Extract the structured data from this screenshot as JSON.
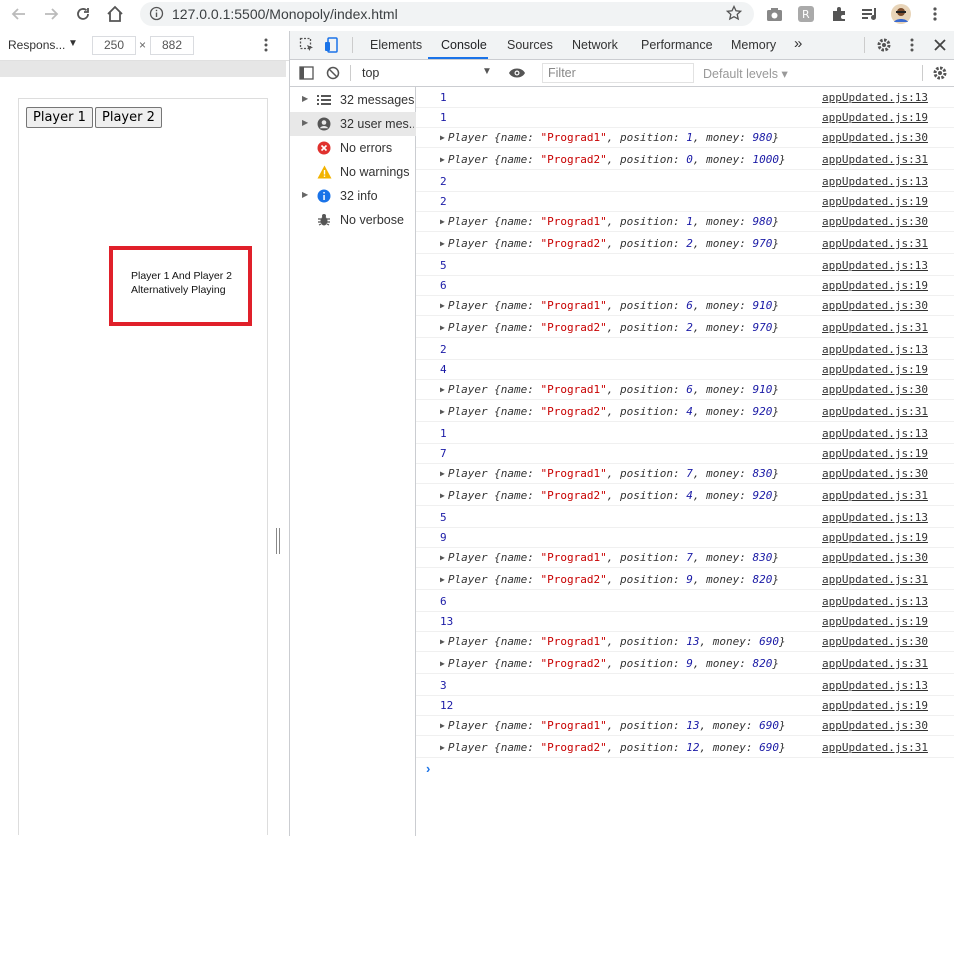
{
  "browser": {
    "url": "127.0.0.1:5500/Monopoly/index.html"
  },
  "device_toolbar": {
    "preset": "Respons...",
    "width": "250",
    "height": "882",
    "times": "×"
  },
  "page": {
    "buttons": [
      "Player 1",
      "Player 2"
    ],
    "message_line1": "Player 1 And Player 2",
    "message_line2": "Alternatively Playing"
  },
  "devtools": {
    "tabs": [
      "Elements",
      "Console",
      "Sources",
      "Network",
      "Performance",
      "Memory"
    ],
    "more_tabs": "»",
    "active_tab": "Console",
    "context": "top",
    "filter_placeholder": "Filter",
    "levels": "Default levels ▾",
    "sidebar": [
      {
        "label": "32 messages",
        "icon": "list-icon",
        "expandable": true
      },
      {
        "label": "32 user mes...",
        "icon": "user-icon",
        "expandable": true
      },
      {
        "label": "No errors",
        "icon": "error-icon",
        "expandable": false
      },
      {
        "label": "No warnings",
        "icon": "warning-icon",
        "expandable": false
      },
      {
        "label": "32 info",
        "icon": "info-icon",
        "expandable": true
      },
      {
        "label": "No verbose",
        "icon": "bug-icon",
        "expandable": false
      }
    ],
    "log": [
      {
        "type": "num",
        "value": "1",
        "src": "appUpdated.js:13"
      },
      {
        "type": "num",
        "value": "1",
        "src": "appUpdated.js:19"
      },
      {
        "type": "obj",
        "name": "Prograd1",
        "position": "1",
        "money": "980",
        "src": "appUpdated.js:30"
      },
      {
        "type": "obj",
        "name": "Prograd2",
        "position": "0",
        "money": "1000",
        "src": "appUpdated.js:31"
      },
      {
        "type": "num",
        "value": "2",
        "src": "appUpdated.js:13"
      },
      {
        "type": "num",
        "value": "2",
        "src": "appUpdated.js:19"
      },
      {
        "type": "obj",
        "name": "Prograd1",
        "position": "1",
        "money": "980",
        "src": "appUpdated.js:30"
      },
      {
        "type": "obj",
        "name": "Prograd2",
        "position": "2",
        "money": "970",
        "src": "appUpdated.js:31"
      },
      {
        "type": "num",
        "value": "5",
        "src": "appUpdated.js:13"
      },
      {
        "type": "num",
        "value": "6",
        "src": "appUpdated.js:19"
      },
      {
        "type": "obj",
        "name": "Prograd1",
        "position": "6",
        "money": "910",
        "src": "appUpdated.js:30"
      },
      {
        "type": "obj",
        "name": "Prograd2",
        "position": "2",
        "money": "970",
        "src": "appUpdated.js:31"
      },
      {
        "type": "num",
        "value": "2",
        "src": "appUpdated.js:13"
      },
      {
        "type": "num",
        "value": "4",
        "src": "appUpdated.js:19"
      },
      {
        "type": "obj",
        "name": "Prograd1",
        "position": "6",
        "money": "910",
        "src": "appUpdated.js:30"
      },
      {
        "type": "obj",
        "name": "Prograd2",
        "position": "4",
        "money": "920",
        "src": "appUpdated.js:31"
      },
      {
        "type": "num",
        "value": "1",
        "src": "appUpdated.js:13"
      },
      {
        "type": "num",
        "value": "7",
        "src": "appUpdated.js:19"
      },
      {
        "type": "obj",
        "name": "Prograd1",
        "position": "7",
        "money": "830",
        "src": "appUpdated.js:30"
      },
      {
        "type": "obj",
        "name": "Prograd2",
        "position": "4",
        "money": "920",
        "src": "appUpdated.js:31"
      },
      {
        "type": "num",
        "value": "5",
        "src": "appUpdated.js:13"
      },
      {
        "type": "num",
        "value": "9",
        "src": "appUpdated.js:19"
      },
      {
        "type": "obj",
        "name": "Prograd1",
        "position": "7",
        "money": "830",
        "src": "appUpdated.js:30"
      },
      {
        "type": "obj",
        "name": "Prograd2",
        "position": "9",
        "money": "820",
        "src": "appUpdated.js:31"
      },
      {
        "type": "num",
        "value": "6",
        "src": "appUpdated.js:13"
      },
      {
        "type": "num",
        "value": "13",
        "src": "appUpdated.js:19"
      },
      {
        "type": "obj",
        "name": "Prograd1",
        "position": "13",
        "money": "690",
        "src": "appUpdated.js:30"
      },
      {
        "type": "obj",
        "name": "Prograd2",
        "position": "9",
        "money": "820",
        "src": "appUpdated.js:31"
      },
      {
        "type": "num",
        "value": "3",
        "src": "appUpdated.js:13"
      },
      {
        "type": "num",
        "value": "12",
        "src": "appUpdated.js:19"
      },
      {
        "type": "obj",
        "name": "Prograd1",
        "position": "13",
        "money": "690",
        "src": "appUpdated.js:30"
      },
      {
        "type": "obj",
        "name": "Prograd2",
        "position": "12",
        "money": "690",
        "src": "appUpdated.js:31"
      }
    ],
    "prompt": "›"
  },
  "colors": {
    "accent": "#1a73e8",
    "message_border": "#e0202a",
    "number": "#1a1aa6",
    "string": "#c80000"
  }
}
